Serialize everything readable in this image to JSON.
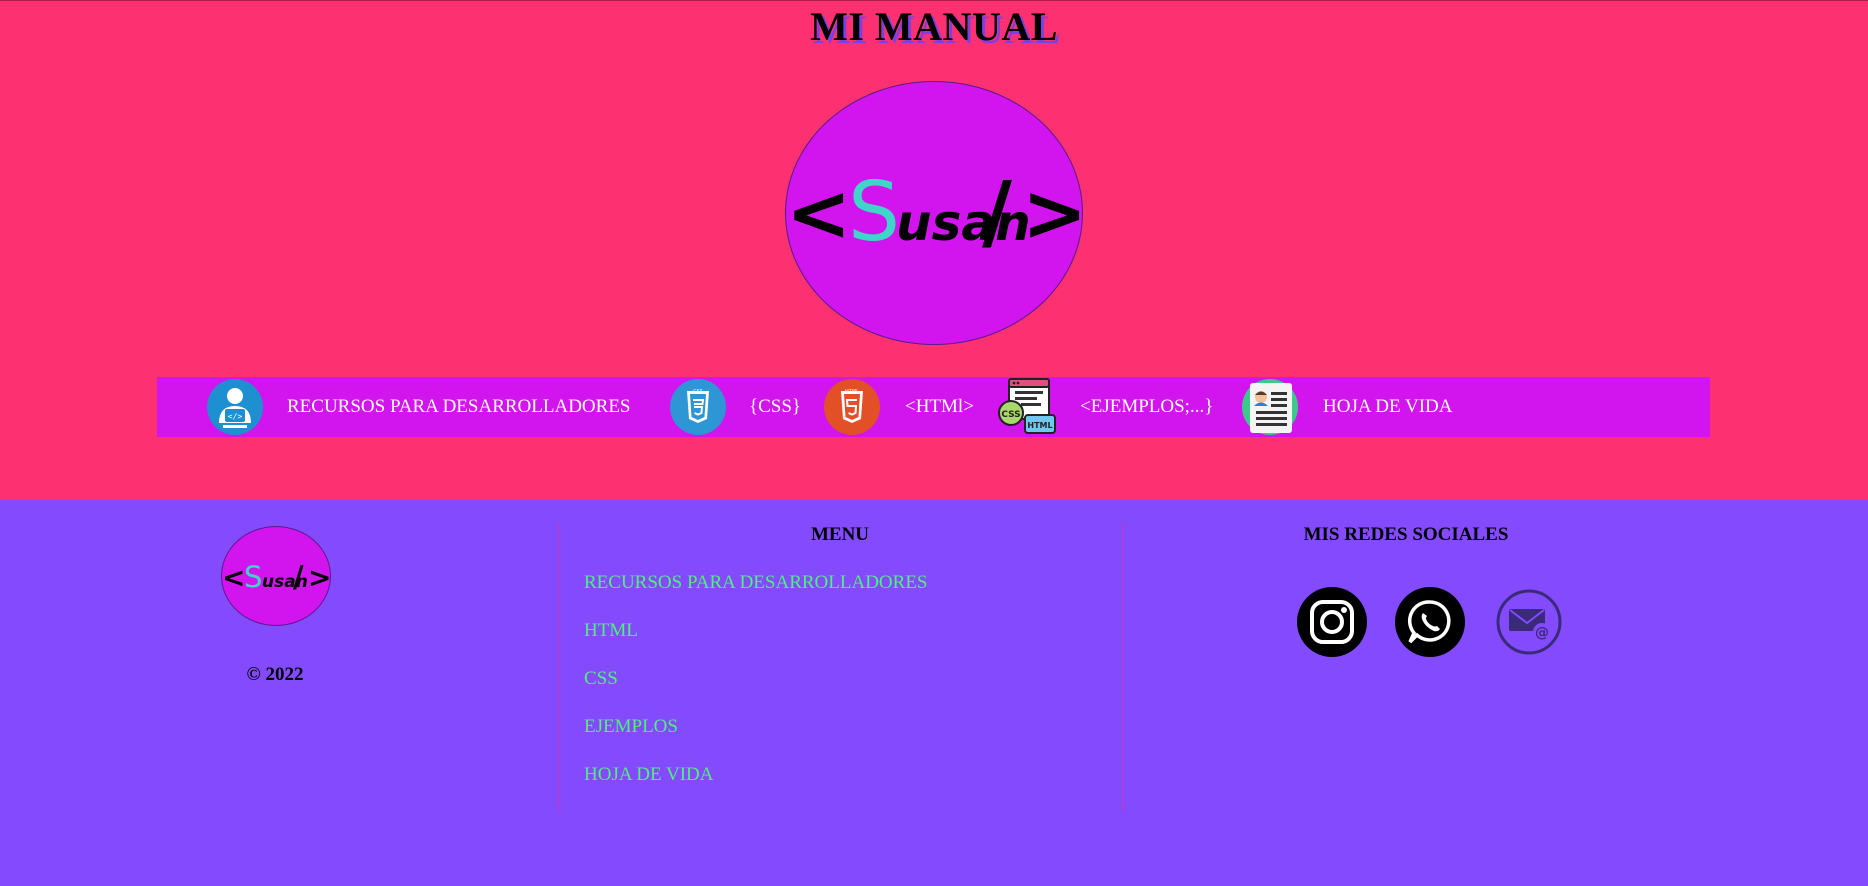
{
  "header": {
    "title": "MI MANUAL",
    "logo": {
      "lt": "<",
      "s": "S",
      "usan": "usan",
      "slash": "/",
      "gt": ">"
    }
  },
  "nav": {
    "items": [
      {
        "icon": "developer-resources-icon",
        "label": "RECURSOS PARA DESARROLLADORES"
      },
      {
        "icon": "css3-icon",
        "label": "{CSS}"
      },
      {
        "icon": "html5-icon",
        "label": "<HTMl>"
      },
      {
        "icon": "css-html-examples-icon",
        "label": "<EJEMPLOS;...}"
      },
      {
        "icon": "resume-icon",
        "label": "HOJA DE VIDA"
      }
    ]
  },
  "footer": {
    "copyright": "© 2022",
    "menu": {
      "heading": "MENU",
      "links": [
        "RECURSOS PARA DESARROLLADORES",
        "HTML",
        "CSS",
        "EJEMPLOS",
        "HOJA DE VIDA"
      ]
    },
    "social": {
      "heading": "MIS REDES SOCIALES",
      "icons": [
        "instagram-icon",
        "whatsapp-icon",
        "email-icon"
      ]
    }
  },
  "colors": {
    "header_bg": "#FD3072",
    "footer_bg": "#844AFE",
    "accent_purple": "#D214EE",
    "logo_teal": "#3DD6C8",
    "link_green": "#4DF27A"
  }
}
